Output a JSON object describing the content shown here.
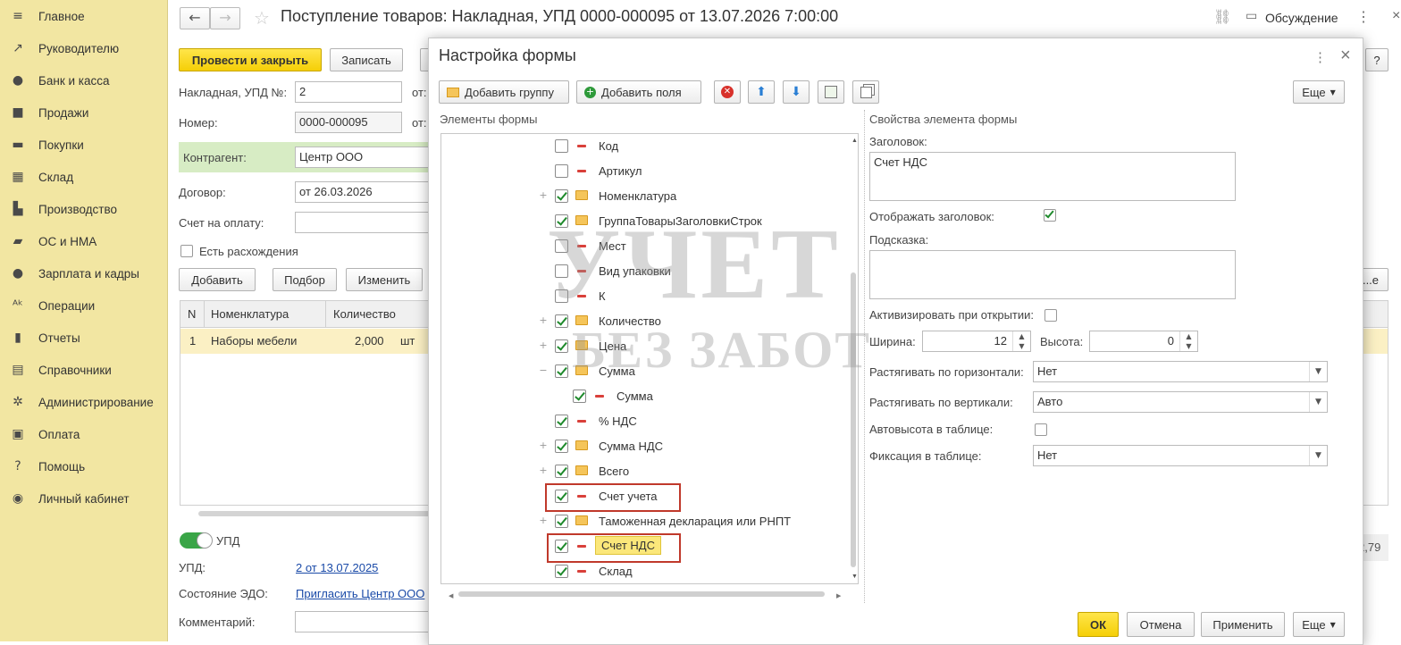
{
  "sidebar": {
    "items": [
      {
        "icon": "menu-icon",
        "glyph": "≡",
        "label": "Главное"
      },
      {
        "icon": "trend-icon",
        "glyph": "↗",
        "label": "Руководителю"
      },
      {
        "icon": "coin-icon",
        "glyph": "●",
        "label": "Банк и касса"
      },
      {
        "icon": "bag-icon",
        "glyph": "■",
        "label": "Продажи"
      },
      {
        "icon": "cart-icon",
        "glyph": "▬",
        "label": "Покупки"
      },
      {
        "icon": "warehouse-icon",
        "glyph": "▦",
        "label": "Склад"
      },
      {
        "icon": "factory-icon",
        "glyph": "▙",
        "label": "Производство"
      },
      {
        "icon": "truck-icon",
        "glyph": "▰",
        "label": "ОС и НМА"
      },
      {
        "icon": "person-icon",
        "glyph": "●",
        "label": "Зарплата и кадры"
      },
      {
        "icon": "operations-icon",
        "glyph": "ᴬᵏ",
        "label": "Операции"
      },
      {
        "icon": "bar-chart-icon",
        "glyph": "▮",
        "label": "Отчеты"
      },
      {
        "icon": "book-icon",
        "glyph": "▤",
        "label": "Справочники"
      },
      {
        "icon": "gear-icon",
        "glyph": "✲",
        "label": "Администрирование"
      },
      {
        "icon": "payment-icon",
        "glyph": "▣",
        "label": "Оплата"
      },
      {
        "icon": "help-icon",
        "glyph": "?",
        "label": "Помощь"
      },
      {
        "icon": "account-icon",
        "glyph": "◉",
        "label": "Личный кабинет"
      }
    ]
  },
  "document": {
    "title": "Поступление товаров: Накладная, УПД 0000-000095 от 13.07.2026 7:00:00",
    "discussion": "Обсуждение",
    "btn_post_close": "Провести и закрыть",
    "btn_save": "Записать",
    "help": "?",
    "lbl_invoice_no": "Накладная, УПД №:",
    "invoice_no": "2",
    "lbl_from1": "от:",
    "lbl_number": "Номер:",
    "number": "0000-000095",
    "lbl_from2": "от:",
    "lbl_counterparty": "Контрагент:",
    "counterparty": "Центр ООО",
    "lbl_contract": "Договор:",
    "contract": "от 26.03.2026",
    "lbl_payment_invoice": "Счет на оплату:",
    "payment_invoice": "",
    "discrepancies": "Есть расхождения",
    "btn_add": "Добавить",
    "btn_pick": "Подбор",
    "btn_edit": "Изменить",
    "table_headers": [
      "N",
      "Номенклатура",
      "Количество"
    ],
    "table_rows": [
      [
        "1",
        "Наборы мебели",
        "2,000",
        "шт"
      ]
    ],
    "more_partial": "...е",
    "total_partial": "2,79",
    "upd_toggle": "УПД",
    "lbl_upd": "УПД:",
    "upd_link": "2 от 13.07.2025",
    "lbl_edo": "Состояние ЭДО:",
    "edo_link": "Пригласить Центр ООО",
    "lbl_comment": "Комментарий:"
  },
  "dialog": {
    "title": "Настройка формы",
    "btn_add_group": "Добавить группу",
    "btn_add_fields": "Добавить поля",
    "btn_more": "Еще",
    "elements_header": "Элементы формы",
    "props_header": "Свойства элемента формы",
    "tree": [
      {
        "label": "Код",
        "checked": false,
        "type": "field",
        "expand": ""
      },
      {
        "label": "Артикул",
        "checked": false,
        "type": "field",
        "expand": ""
      },
      {
        "label": "Номенклатура",
        "checked": true,
        "type": "group",
        "expand": "+"
      },
      {
        "label": "ГруппаТоварыЗаголовкиСтрок",
        "checked": true,
        "type": "group",
        "expand": ""
      },
      {
        "label": "Мест",
        "checked": false,
        "type": "field",
        "expand": ""
      },
      {
        "label": "Вид упаковки",
        "checked": false,
        "type": "field",
        "expand": ""
      },
      {
        "label": "К",
        "checked": false,
        "type": "field",
        "expand": ""
      },
      {
        "label": "Количество",
        "checked": true,
        "type": "group",
        "expand": "+"
      },
      {
        "label": "Цена",
        "checked": true,
        "type": "group",
        "expand": "+"
      },
      {
        "label": "Сумма",
        "checked": true,
        "type": "group",
        "expand": "−"
      },
      {
        "label": "Сумма",
        "checked": true,
        "type": "field",
        "expand": "",
        "child": true
      },
      {
        "label": "% НДС",
        "checked": true,
        "type": "field",
        "expand": ""
      },
      {
        "label": "Сумма НДС",
        "checked": true,
        "type": "group",
        "expand": "+"
      },
      {
        "label": "Всего",
        "checked": true,
        "type": "group",
        "expand": "+"
      },
      {
        "label": "Счет учета",
        "checked": true,
        "type": "field",
        "expand": ""
      },
      {
        "label": "Таможенная декларация или РНПТ",
        "checked": true,
        "type": "group",
        "expand": "+"
      },
      {
        "label": "Счет НДС",
        "checked": true,
        "type": "field",
        "expand": "",
        "selected": true
      },
      {
        "label": "Склад",
        "checked": true,
        "type": "field",
        "expand": ""
      }
    ],
    "props": {
      "lbl_caption": "Заголовок:",
      "caption": "Счет НДС",
      "lbl_show_caption": "Отображать заголовок:",
      "show_caption": true,
      "lbl_hint": "Подсказка:",
      "hint": "",
      "lbl_activate": "Активизировать при открытии:",
      "lbl_width": "Ширина:",
      "width": "12",
      "lbl_height": "Высота:",
      "height": "0",
      "lbl_stretch_h": "Растягивать по горизонтали:",
      "stretch_h": "Нет",
      "lbl_stretch_v": "Растягивать по вертикали:",
      "stretch_v": "Авто",
      "lbl_autoheight": "Автовысота в таблице:",
      "lbl_fixation": "Фиксация в таблице:",
      "fixation": "Нет"
    },
    "btn_ok": "ОК",
    "btn_cancel": "Отмена",
    "btn_apply": "Применить",
    "btn_more2": "Еще"
  },
  "watermark": {
    "line1": "УЧЕТ",
    "line2": "БЕЗ ЗАБОТ"
  },
  "colors": {
    "sidebar_bg": "#f2e6a2",
    "accent_yellow": "#f5cf07",
    "check_green": "#1f8a2c",
    "highlight_red": "#c0392b"
  }
}
